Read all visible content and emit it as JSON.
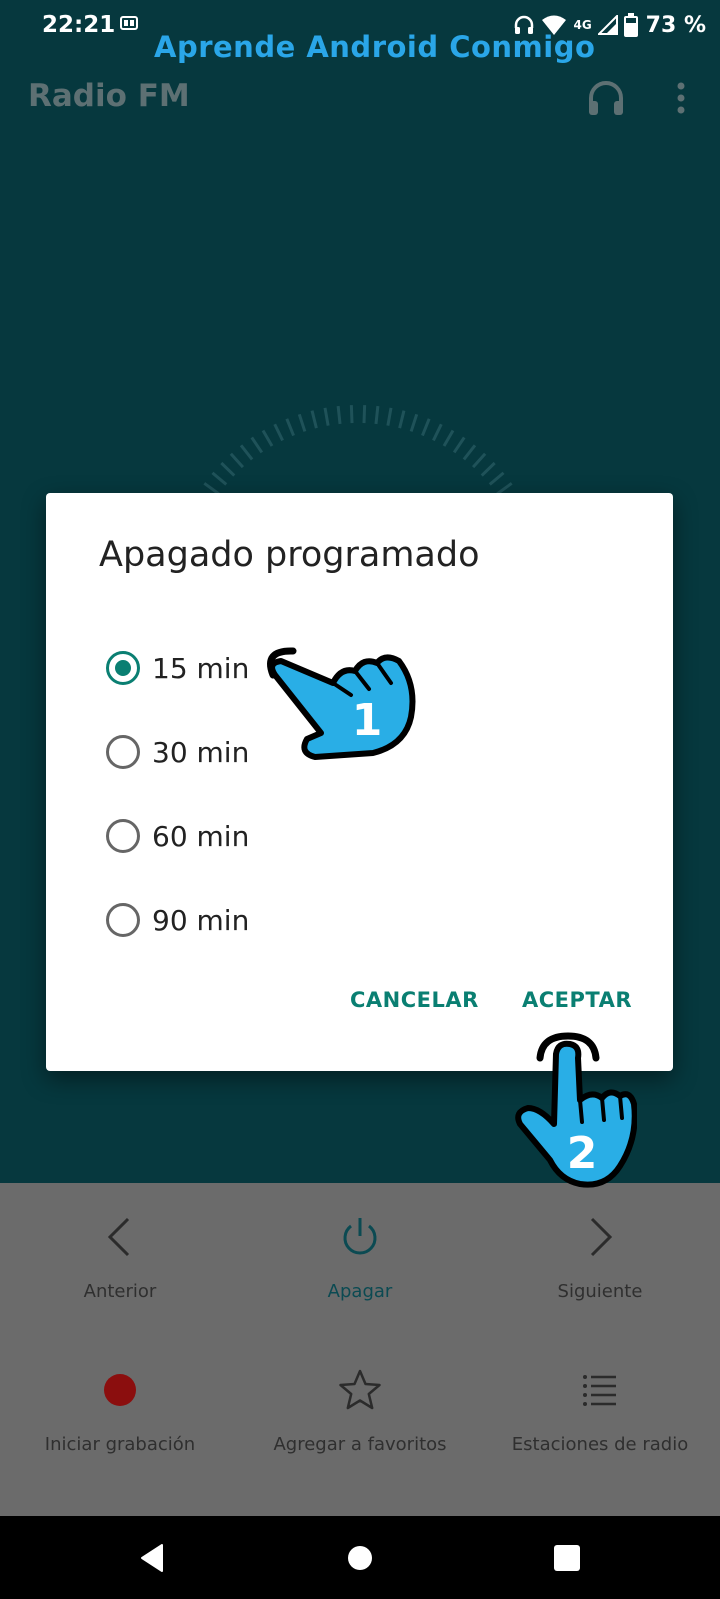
{
  "status_bar": {
    "time": "22:21",
    "network": "4G",
    "battery": "73 %"
  },
  "watermark": "Aprende Android Conmigo",
  "app_bar": {
    "title": "Radio FM",
    "icons": [
      "headphones-icon",
      "more-vert-icon"
    ]
  },
  "dialog": {
    "title": "Apagado programado",
    "options": [
      {
        "label": "15 min",
        "selected": true
      },
      {
        "label": "30 min",
        "selected": false
      },
      {
        "label": "60 min",
        "selected": false
      },
      {
        "label": "90 min",
        "selected": false
      }
    ],
    "cancel_label": "CANCELAR",
    "accept_label": "ACEPTAR"
  },
  "controls": {
    "previous": "Anterior",
    "power_off": "Apagar",
    "next": "Siguiente",
    "record": "Iniciar grabación",
    "favorite": "Agregar a favoritos",
    "stations": "Estaciones de radio"
  },
  "annotations": {
    "step_1": "1",
    "step_2": "2"
  },
  "colors": {
    "app_background": "#06383e",
    "accent": "#0a7f72",
    "record_dot": "#8b0e0e",
    "hand_fill": "#29aee6"
  }
}
